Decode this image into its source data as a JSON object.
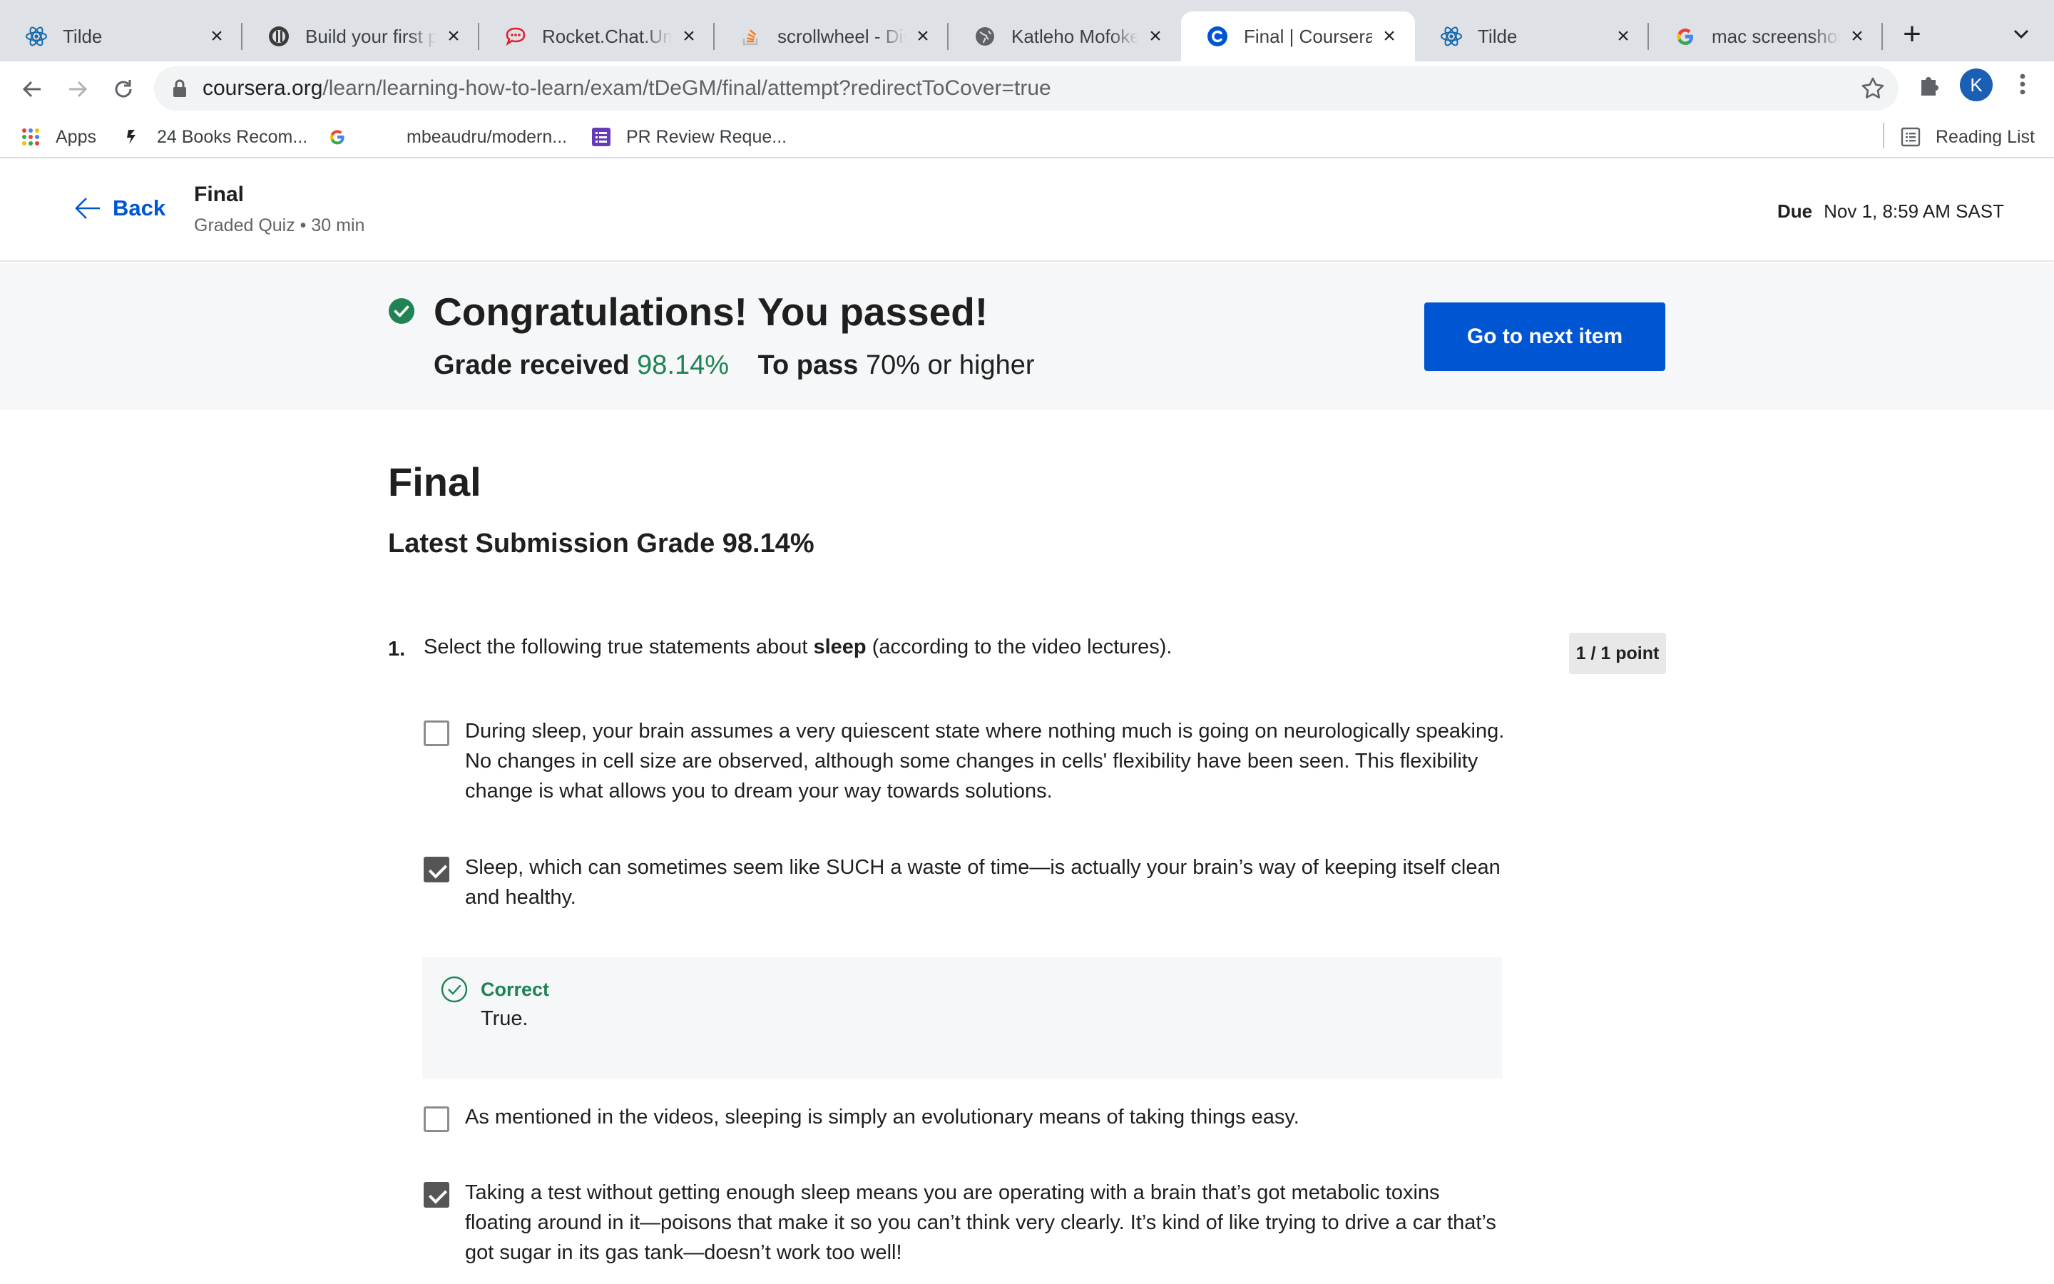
{
  "browser": {
    "tabs": [
      {
        "title": "Tilde",
        "favicon": "react-icon"
      },
      {
        "title": "Build your first pe",
        "favicon": "github-icon"
      },
      {
        "title": "Rocket.Chat.Umu",
        "favicon": "rocketchat-icon"
      },
      {
        "title": "scrollwheel - Disa",
        "favicon": "stackoverflow-icon"
      },
      {
        "title": "Katleho Mofokeng",
        "favicon": "globe-icon"
      },
      {
        "title": "Final | Coursera",
        "favicon": "coursera-icon",
        "active": true
      },
      {
        "title": "Tilde",
        "favicon": "react-icon"
      },
      {
        "title": "mac screenshot -",
        "favicon": "google-icon"
      }
    ],
    "new_tab_label": "+",
    "url_host": "coursera.org",
    "url_path": "/learn/learning-how-to-learn/exam/tDeGM/final/attempt?redirectToCover=true",
    "profile_initial": "K",
    "bookmarks": [
      {
        "label": "Apps",
        "icon": "apps-grid-icon"
      },
      {
        "label": "24 Books Recom...",
        "icon": "book-icon"
      },
      {
        "label": "",
        "icon": "google-icon"
      },
      {
        "label": "mbeaudru/modern...",
        "icon": "github-icon"
      },
      {
        "label": "PR Review Reque...",
        "icon": "form-icon"
      }
    ],
    "reading_list": "Reading List"
  },
  "course_header": {
    "back_label": "Back",
    "title": "Final",
    "meta": "Graded Quiz • 30 min",
    "due_label": "Due",
    "due_value": "Nov 1, 8:59 AM SAST"
  },
  "banner": {
    "headline": "Congratulations! You passed!",
    "grade_label": "Grade received",
    "grade_value": "98.14%",
    "pass_label": "To pass",
    "pass_value": "70% or higher",
    "next_button": "Go to next item"
  },
  "quiz": {
    "title": "Final",
    "latest_grade": "Latest Submission Grade 98.14%",
    "question": {
      "number": "1.",
      "text_before": "Select the following true statements about ",
      "text_bold": "sleep",
      "text_after": " (according to the video lectures).",
      "points": "1 / 1 point"
    },
    "options": [
      {
        "text": "During sleep, your brain assumes a very quiescent state where nothing much is going on neurologically speaking.  No changes in cell size are observed, although some changes in cells' flexibility have been seen.  This flexibility change is what allows you to dream your way towards solutions.",
        "checked": false
      },
      {
        "text": "Sleep, which can sometimes seem like SUCH a waste of time—is actually your brain’s way of keeping itself clean and healthy.",
        "checked": true
      },
      {
        "text": "As mentioned in the videos, sleeping is simply an evolutionary means of taking things easy.",
        "checked": false
      },
      {
        "text": "Taking a test without getting enough sleep means you are operating with a brain that’s got  metabolic toxins floating around in it—poisons that make it so you can’t think very clearly. It’s kind of like trying to drive a car that’s got sugar in its gas tank—doesn’t work too well!",
        "checked": true
      }
    ],
    "feedback": {
      "label": "Correct",
      "text": "True."
    }
  },
  "colors": {
    "accent": "#0056d2",
    "success": "#1f8354",
    "banner_bg": "#f5f7f8"
  }
}
